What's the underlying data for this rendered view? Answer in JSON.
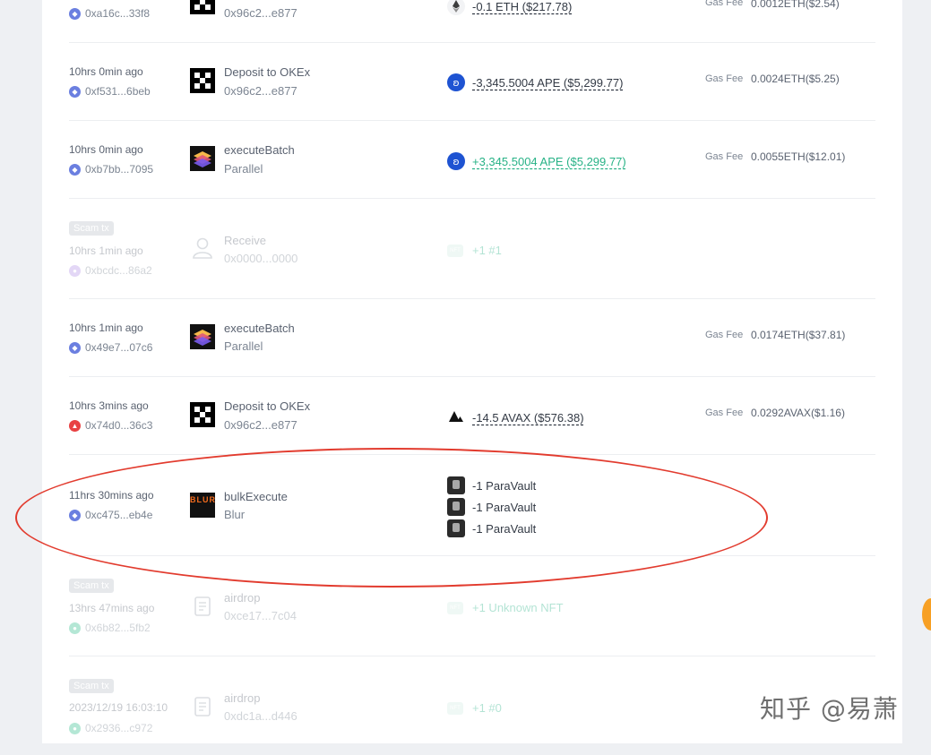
{
  "colors": {
    "scam_badge": "#b8bec7",
    "positive": "#27b286",
    "annotation": "#e23b2e"
  },
  "rows": [
    {
      "time": "",
      "chain": "eth",
      "address": "0xa16c...33f8",
      "project_name": "",
      "project_sub": "0x96c2...e877",
      "project_logo": "okex-logo-icon",
      "amount": "-0.1 ETH ($217.78)",
      "amount_icon": "eth-token-icon",
      "gas_label": "Gas Fee",
      "gas_value": "0.0012ETH($2.54)"
    },
    {
      "time": "10hrs 0min ago",
      "chain": "eth",
      "address": "0xf531...6beb",
      "project_name": "Deposit to OKEx",
      "project_sub": "0x96c2...e877",
      "project_logo": "okex-logo-icon",
      "amount": "-3,345.5004 APE ($5,299.77)",
      "amount_icon": "ape-token-icon",
      "gas_label": "Gas Fee",
      "gas_value": "0.0024ETH($5.25)"
    },
    {
      "time": "10hrs 0min ago",
      "chain": "eth",
      "address": "0xb7bb...7095",
      "project_name": "executeBatch",
      "project_sub": "Parallel",
      "project_logo": "parallel-logo-icon",
      "amount": "+3,345.5004 APE ($5,299.77)",
      "amount_icon": "ape-token-icon",
      "gas_label": "Gas Fee",
      "gas_value": "0.0055ETH($12.01)"
    },
    {
      "scam": "Scam tx",
      "time": "10hrs 1min ago",
      "chain": "purple",
      "address": "0xbcdc...86a2",
      "project_name": "Receive",
      "project_sub": "0x0000...0000",
      "project_logo": "user-icon",
      "nft_badge": "NFT",
      "nft_text": "+1 #1"
    },
    {
      "time": "10hrs 1min ago",
      "chain": "eth",
      "address": "0x49e7...07c6",
      "project_name": "executeBatch",
      "project_sub": "Parallel",
      "project_logo": "parallel-logo-icon",
      "gas_label": "Gas Fee",
      "gas_value": "0.0174ETH($37.81)"
    },
    {
      "time": "10hrs 3mins ago",
      "chain": "avax",
      "address": "0x74d0...36c3",
      "project_name": "Deposit to OKEx",
      "project_sub": "0x96c2...e877",
      "project_logo": "okex-logo-icon",
      "amount": "-14.5 AVAX ($576.38)",
      "amount_icon": "avax-token-icon",
      "gas_label": "Gas Fee",
      "gas_value": "0.0292AVAX($1.16)"
    },
    {
      "time": "11hrs 30mins ago",
      "chain": "eth",
      "address": "0xc475...eb4e",
      "project_name": "bulkExecute",
      "project_sub": "Blur",
      "project_logo": "blur-logo-icon",
      "nfts": [
        "-1 ParaVault",
        "-1 ParaVault",
        "-1 ParaVault"
      ]
    },
    {
      "scam": "Scam tx",
      "time": "13hrs 47mins ago",
      "chain": "green",
      "address": "0x6b82...5fb2",
      "project_name": "airdrop",
      "project_sub": "0xce17...7c04",
      "project_logo": "contract-icon",
      "nft_badge": "NFT",
      "nft_text": "+1 Unknown NFT"
    },
    {
      "scam": "Scam tx",
      "time": "2023/12/19 16:03:10",
      "chain": "green",
      "address": "0x2936...c972",
      "project_name": "airdrop",
      "project_sub": "0xdc1a...d446",
      "project_logo": "contract-icon",
      "nft_badge": "NFT",
      "nft_text": "+1 #0"
    }
  ],
  "blur_logo_text": "BLUR",
  "watermark": "知乎 @易萧"
}
